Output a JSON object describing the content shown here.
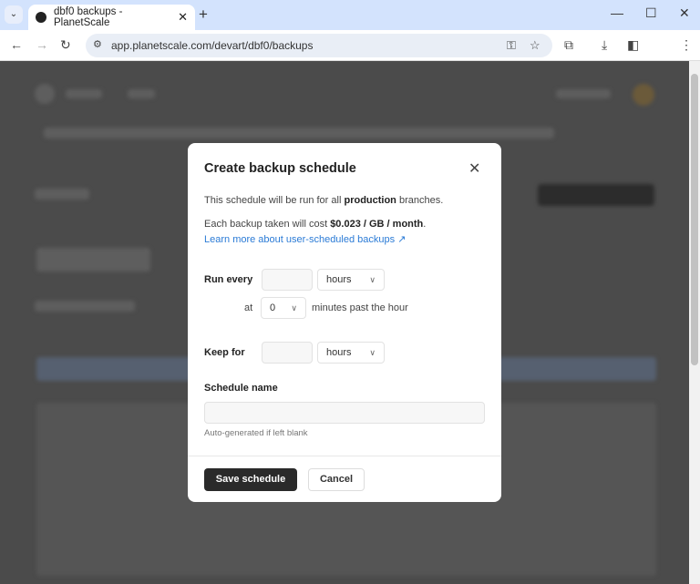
{
  "browser": {
    "tab_title": "dbf0 backups - PlanetScale",
    "url": "app.planetscale.com/devart/dbf0/backups"
  },
  "modal": {
    "title": "Create backup schedule",
    "line1_pre": "This schedule will be run for all ",
    "line1_bold": "production",
    "line1_post": " branches.",
    "line2_pre": "Each backup taken will cost ",
    "line2_bold": "$0.023 / GB / month",
    "line2_post": ".",
    "learn_more": "Learn more about user-scheduled backups",
    "run_every_label": "Run every",
    "run_every_value": "",
    "run_every_unit": "hours",
    "at_label": "at",
    "minute_value": "0",
    "minutes_suffix": "minutes past the hour",
    "keep_for_label": "Keep for",
    "keep_for_value": "",
    "keep_for_unit": "hours",
    "schedule_name_label": "Schedule name",
    "schedule_name_value": "",
    "schedule_name_hint": "Auto-generated if left blank",
    "save_label": "Save schedule",
    "cancel_label": "Cancel"
  }
}
